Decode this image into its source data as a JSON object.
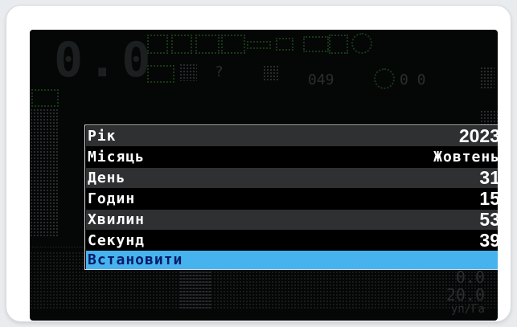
{
  "colors": {
    "screen_bg": "#050606",
    "row_alt": "#2f3032",
    "selected_bg": "#47b3ee",
    "selected_text": "#001a66",
    "text": "#ffffff"
  },
  "background": {
    "speed_display": "0.0",
    "small_reading": "049",
    "right_readout": "0 0",
    "bottom_value_1": "0.0",
    "bottom_value_2": "20.0",
    "unit": "уп/Га"
  },
  "datetime_menu": {
    "rows": [
      {
        "label": "Рік",
        "value": "2023"
      },
      {
        "label": "Місяць",
        "value": "Жовтень"
      },
      {
        "label": "День",
        "value": "31"
      },
      {
        "label": "Годин",
        "value": "15"
      },
      {
        "label": "Хвилин",
        "value": "53"
      },
      {
        "label": "Секунд",
        "value": "39"
      }
    ],
    "action_label": "Встановити"
  }
}
